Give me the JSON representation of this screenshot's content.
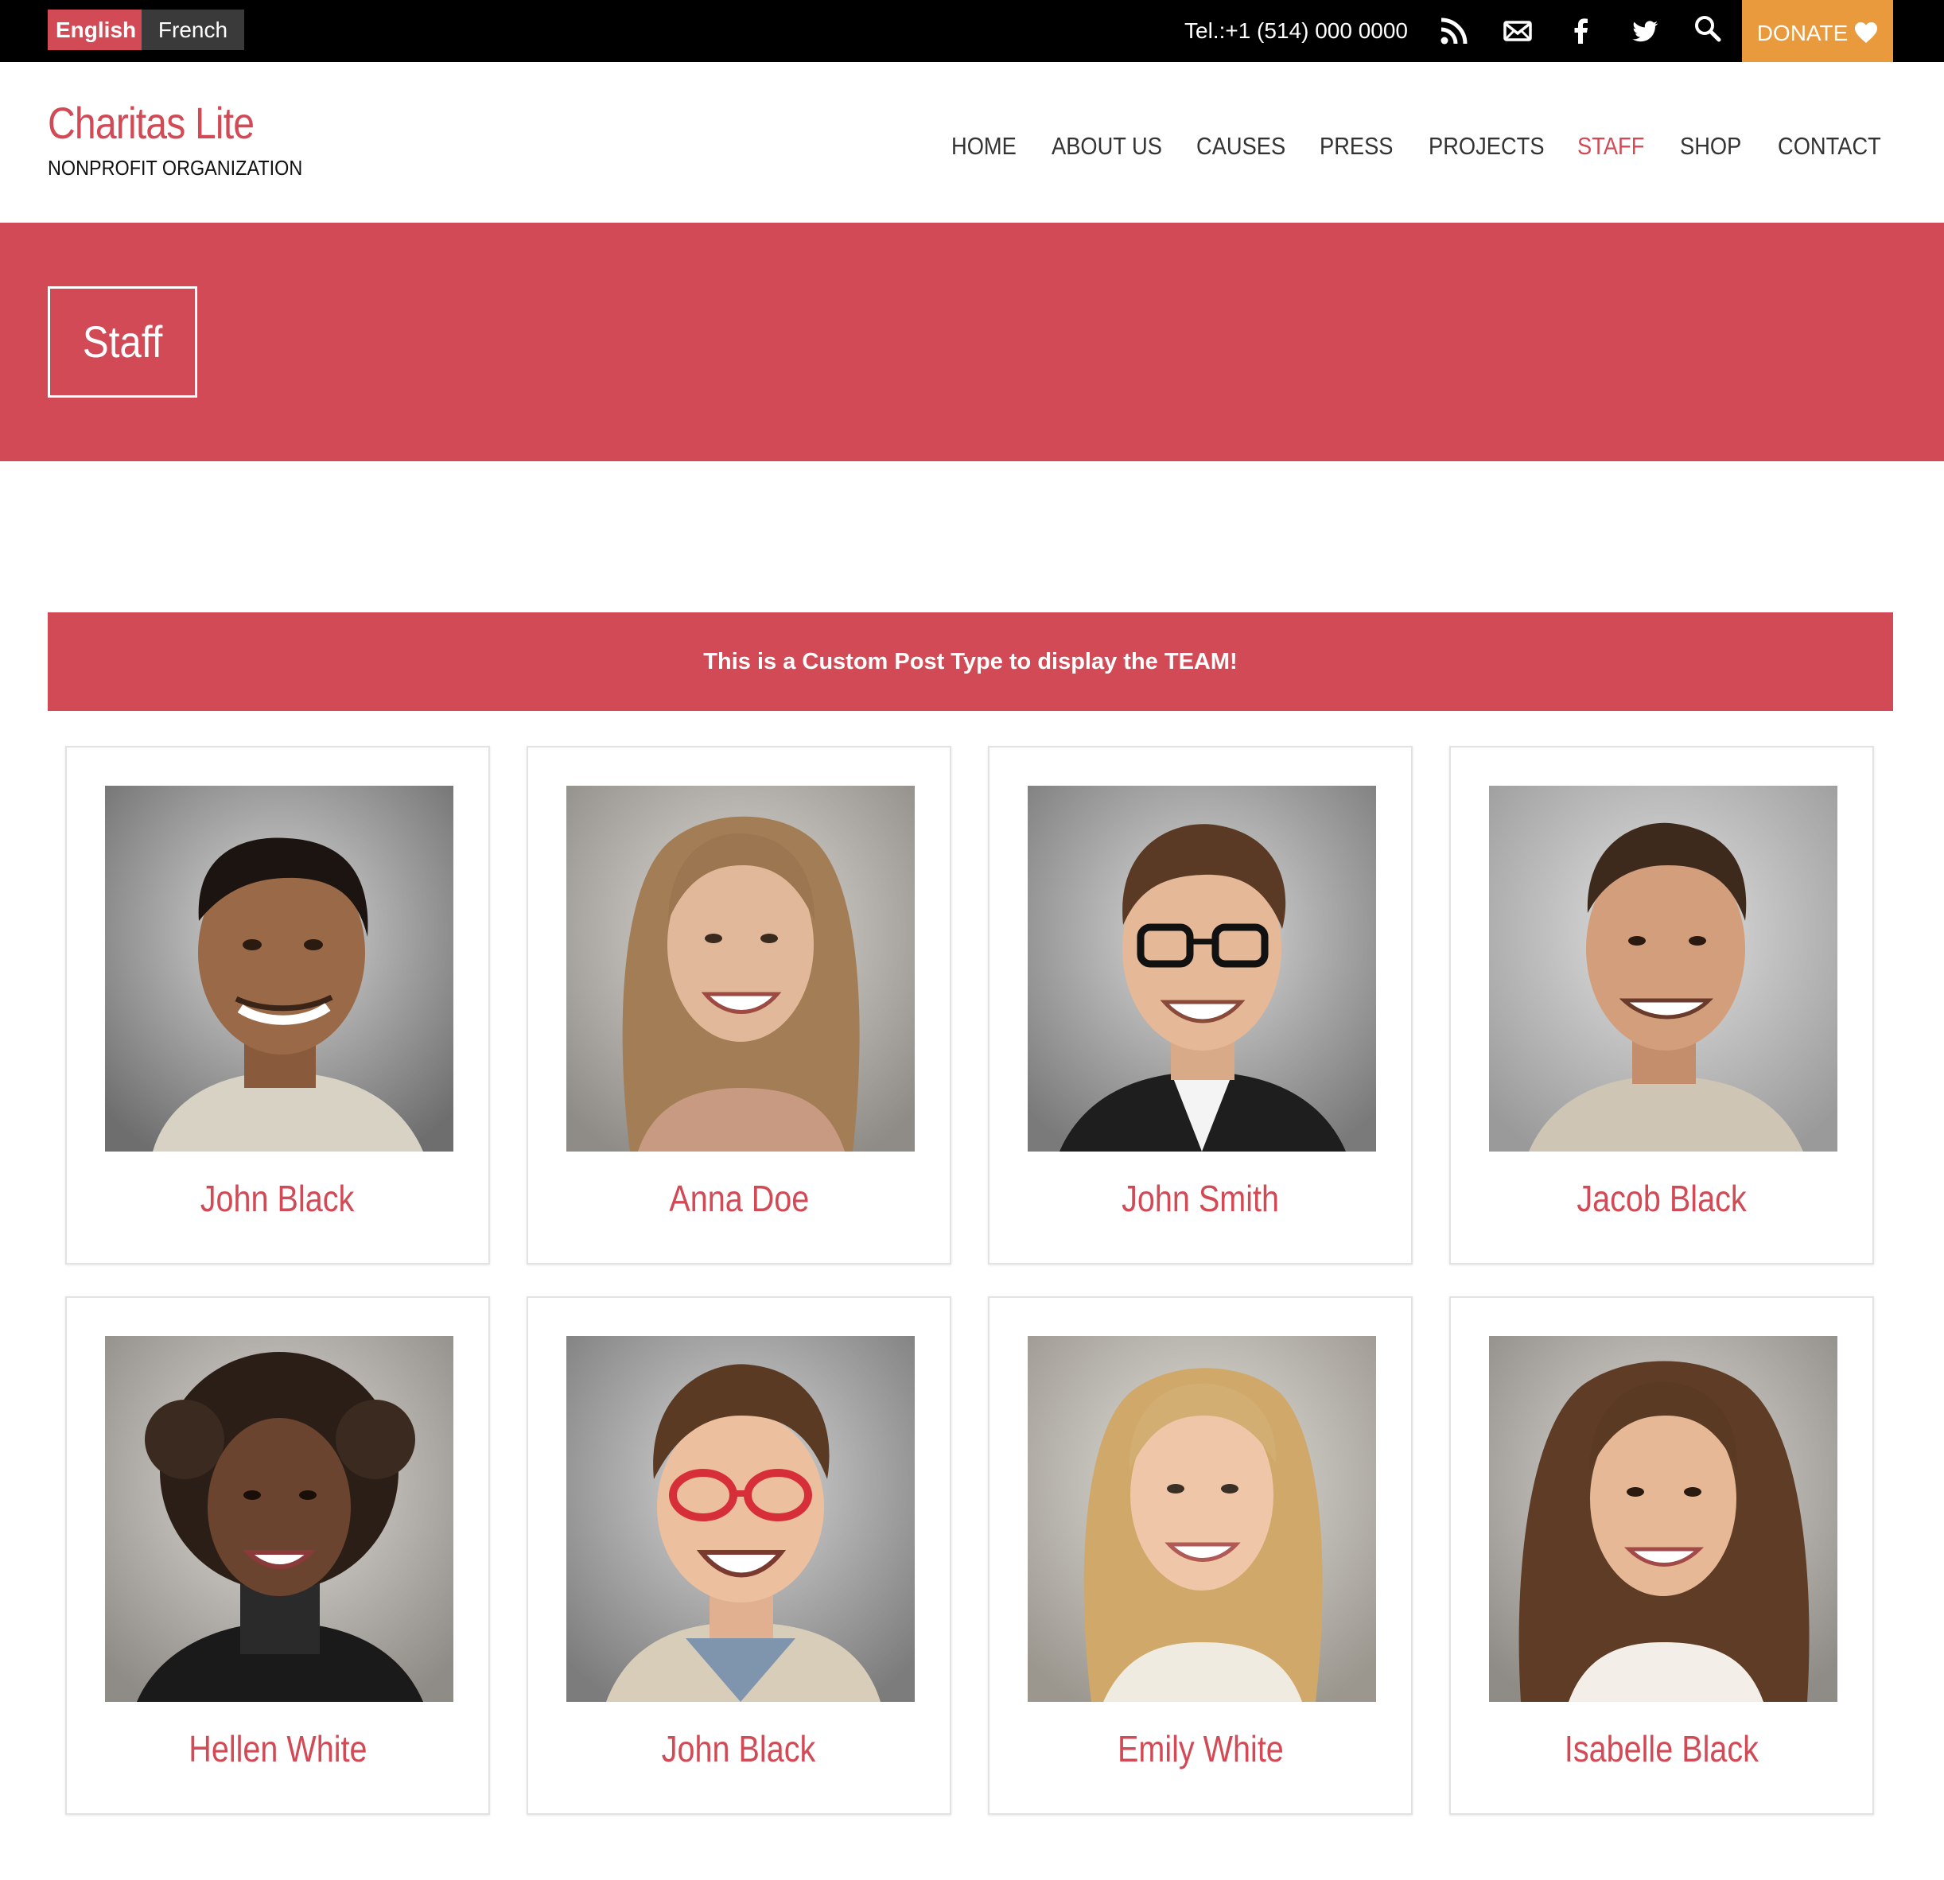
{
  "topbar": {
    "languages": [
      {
        "label": "English",
        "active": true
      },
      {
        "label": "French",
        "active": false
      }
    ],
    "phone": "Tel.:+1 (514) 000 0000",
    "icons": [
      "rss-icon",
      "mail-icon",
      "facebook-icon",
      "twitter-icon",
      "search-icon"
    ],
    "donate_label": "DONATE",
    "colors": {
      "background": "#000000",
      "accent": "#d24a55",
      "donate": "#e89a3c"
    }
  },
  "header": {
    "site_title": "Charitas Lite",
    "tagline": "NONPROFIT ORGANIZATION"
  },
  "nav": {
    "items": [
      {
        "label": "HOME"
      },
      {
        "label": "ABOUT US"
      },
      {
        "label": "CAUSES"
      },
      {
        "label": "PRESS"
      },
      {
        "label": "PROJECTS"
      },
      {
        "label": "STAFF",
        "active": true
      },
      {
        "label": "SHOP"
      },
      {
        "label": "CONTACT"
      }
    ]
  },
  "banner": {
    "title": "Staff",
    "color": "#d24a55"
  },
  "notice": {
    "text": "This is a Custom Post Type to display the TEAM!"
  },
  "staff": [
    {
      "name": "John Black",
      "photo": "portrait-man-smiling"
    },
    {
      "name": "Anna Doe",
      "photo": "portrait-woman-long-hair"
    },
    {
      "name": "John Smith",
      "photo": "portrait-man-glasses-suit"
    },
    {
      "name": "Jacob Black",
      "photo": "portrait-man-stubble"
    },
    {
      "name": "Hellen White",
      "photo": "portrait-woman-curly-hair"
    },
    {
      "name": "John Black",
      "photo": "portrait-boy-red-glasses"
    },
    {
      "name": "Emily White",
      "photo": "portrait-woman-blonde"
    },
    {
      "name": "Isabelle Black",
      "photo": "portrait-woman-brown-wavy-hair"
    }
  ]
}
